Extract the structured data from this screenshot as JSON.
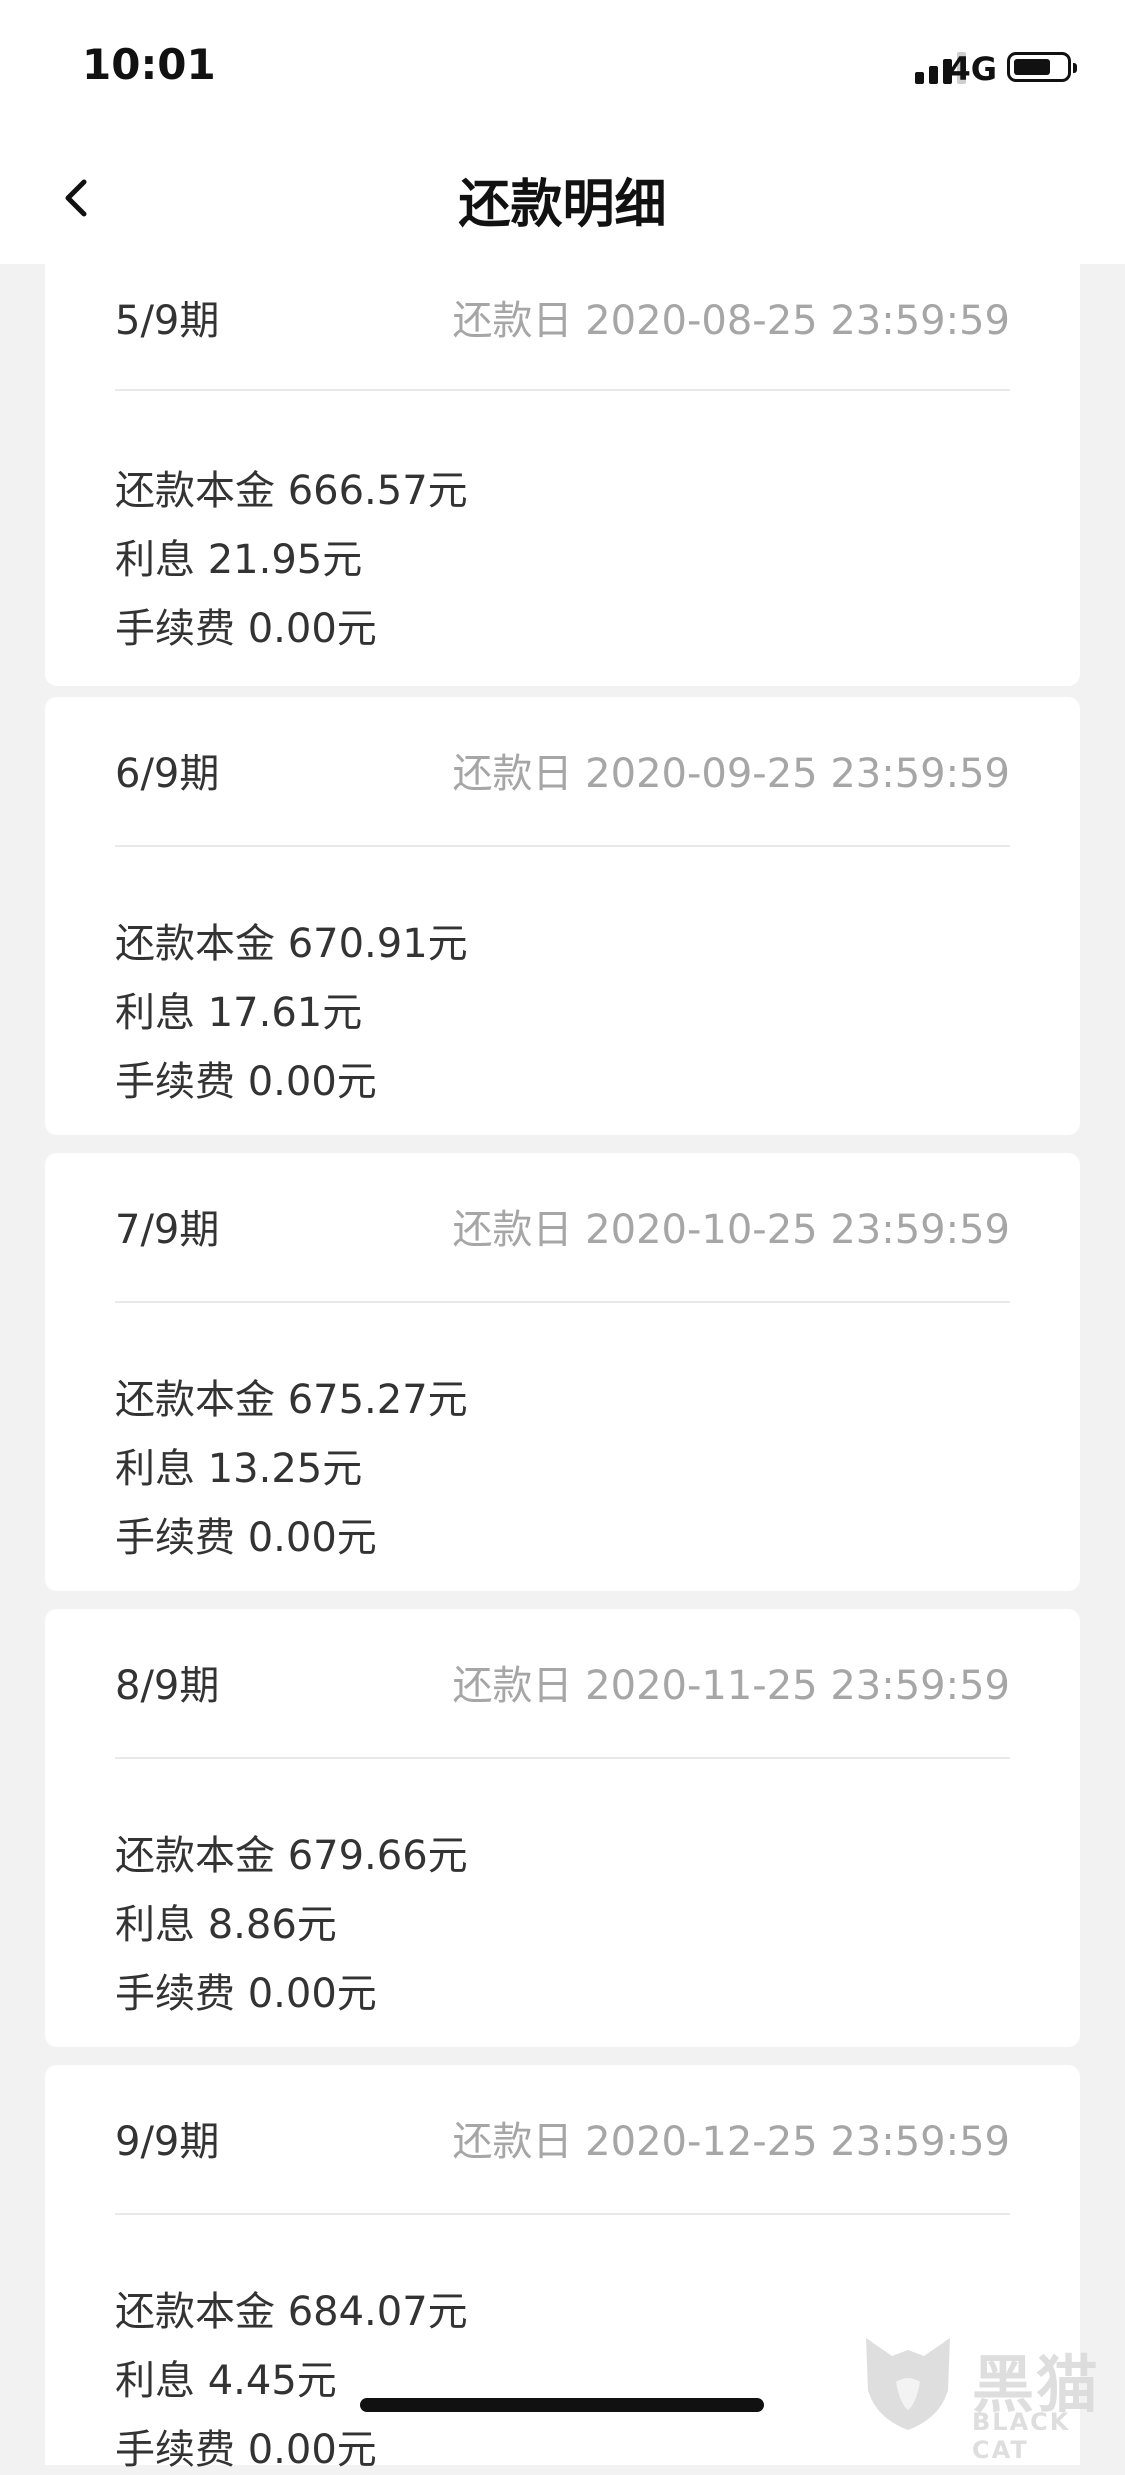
{
  "status_bar": {
    "time": "10:01",
    "network": "4G",
    "icons": [
      "signal-icon",
      "battery-icon"
    ]
  },
  "nav": {
    "back_icon": "chevron-left-icon",
    "title": "还款明细"
  },
  "installments": [
    {
      "period": "5/9期",
      "due_date": "还款日 2020-08-25 23:59:59",
      "principal": "还款本金 666.57元",
      "interest": "利息 21.95元",
      "fee": "手续费 0.00元"
    },
    {
      "period": "6/9期",
      "due_date": "还款日 2020-09-25 23:59:59",
      "principal": "还款本金 670.91元",
      "interest": "利息 17.61元",
      "fee": "手续费 0.00元"
    },
    {
      "period": "7/9期",
      "due_date": "还款日 2020-10-25 23:59:59",
      "principal": "还款本金 675.27元",
      "interest": "利息 13.25元",
      "fee": "手续费 0.00元"
    },
    {
      "period": "8/9期",
      "due_date": "还款日 2020-11-25 23:59:59",
      "principal": "还款本金 679.66元",
      "interest": "利息 8.86元",
      "fee": "手续费 0.00元"
    },
    {
      "period": "9/9期",
      "due_date": "还款日 2020-12-25 23:59:59",
      "principal": "还款本金 684.07元",
      "interest": "利息 4.45元",
      "fee": "手续费 0.00元"
    }
  ],
  "watermark": {
    "logo_text": "黑猫",
    "sub_text": "BLACK CAT"
  }
}
